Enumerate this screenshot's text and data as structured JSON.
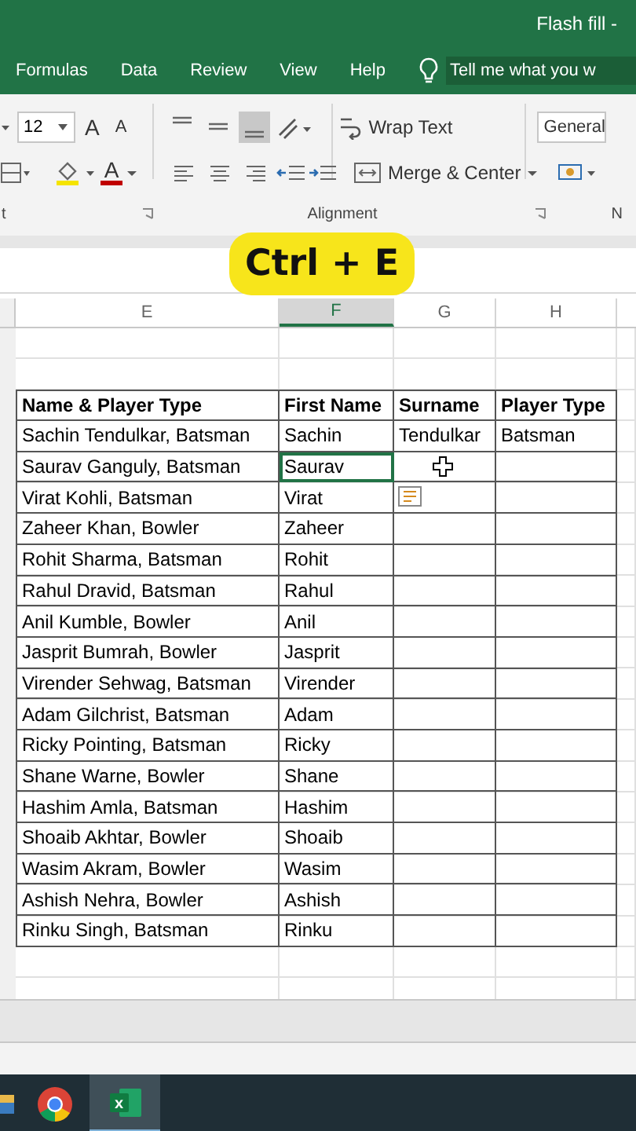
{
  "window": {
    "title": "Flash fill -"
  },
  "menu": [
    {
      "label": "Formulas",
      "selected": false
    },
    {
      "label": "Data",
      "selected": false
    },
    {
      "label": "Review",
      "selected": false
    },
    {
      "label": "View",
      "selected": false
    },
    {
      "label": "Help",
      "selected": false
    }
  ],
  "tell_me": {
    "placeholder": "Tell me what you w"
  },
  "ribbon": {
    "font_size": "12",
    "grow_font": "A",
    "shrink_font": "A",
    "font_color_letter": "A",
    "vertical_align": [
      {
        "selected": false
      },
      {
        "selected": false
      },
      {
        "selected": true
      }
    ],
    "wrap_text": "Wrap Text",
    "merge": "Merge & Center",
    "number_format": "General",
    "groups": [
      "t",
      "Alignment",
      "N"
    ]
  },
  "shortcut_badge": "Ctrl + E",
  "columns": [
    {
      "label": "E",
      "selected": false
    },
    {
      "label": "F",
      "selected": true
    },
    {
      "label": "G",
      "selected": false
    },
    {
      "label": "H",
      "selected": false
    }
  ],
  "table": {
    "header": [
      "Name & Player Type",
      "First Name",
      "Surname",
      "Player Type"
    ],
    "rows": [
      {
        "name_type": "Sachin Tendulkar, Batsman",
        "first_name": "Sachin",
        "surname": "Tendulkar",
        "player_type": "Batsman",
        "selected": false
      },
      {
        "name_type": "Saurav Ganguly, Batsman",
        "first_name": "Saurav",
        "selected": true
      },
      {
        "name_type": "Virat Kohli, Batsman",
        "first_name": "Virat",
        "selected": false
      },
      {
        "name_type": "Zaheer Khan, Bowler",
        "first_name": "Zaheer",
        "selected": false
      },
      {
        "name_type": "Rohit Sharma, Batsman",
        "first_name": "Rohit",
        "selected": false
      },
      {
        "name_type": "Rahul Dravid, Batsman",
        "first_name": "Rahul",
        "selected": false
      },
      {
        "name_type": "Anil Kumble, Bowler",
        "first_name": "Anil",
        "selected": false
      },
      {
        "name_type": "Jasprit Bumrah, Bowler",
        "first_name": "Jasprit",
        "selected": false
      },
      {
        "name_type": "Virender Sehwag, Batsman",
        "first_name": "Virender",
        "selected": false
      },
      {
        "name_type": "Adam Gilchrist, Batsman",
        "first_name": "Adam",
        "selected": false
      },
      {
        "name_type": "Ricky Pointing, Batsman",
        "first_name": "Ricky",
        "selected": false
      },
      {
        "name_type": "Shane Warne, Bowler",
        "first_name": "Shane",
        "selected": false
      },
      {
        "name_type": "Hashim Amla, Batsman",
        "first_name": "Hashim",
        "selected": false
      },
      {
        "name_type": "Shoaib Akhtar, Bowler",
        "first_name": "Shoaib",
        "selected": false
      },
      {
        "name_type": "Wasim Akram, Bowler",
        "first_name": "Wasim",
        "selected": false
      },
      {
        "name_type": "Ashish Nehra, Bowler",
        "first_name": "Ashish",
        "selected": false
      },
      {
        "name_type": "Rinku Singh, Batsman",
        "first_name": "Rinku",
        "selected": false
      }
    ]
  },
  "taskbar": [
    {
      "kind": "folder",
      "selected": false
    },
    {
      "kind": "browser",
      "selected": false
    },
    {
      "kind": "spreadsheet",
      "glyph": "x",
      "selected": true
    }
  ]
}
